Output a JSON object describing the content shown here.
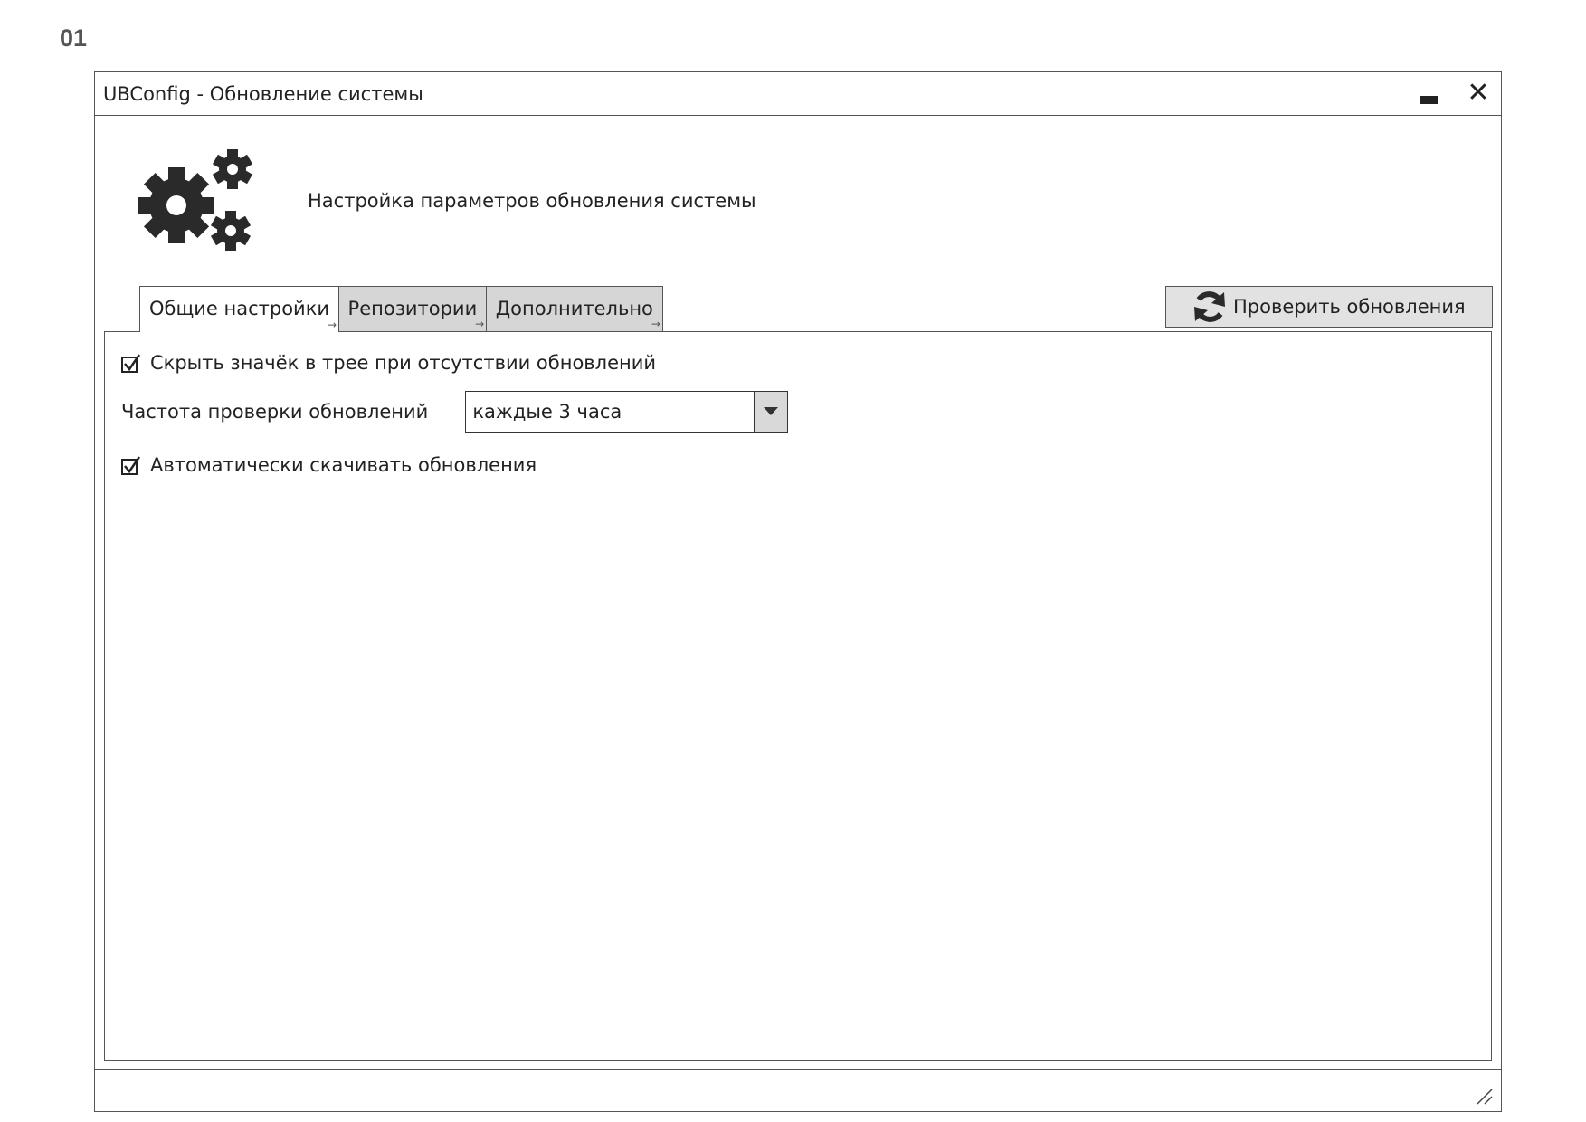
{
  "page": {
    "number": "01"
  },
  "window": {
    "title": "UBConfig - Обновление системы",
    "minimize_icon": "minimize-icon",
    "close_icon": "close-icon",
    "close_glyph": "✕"
  },
  "header": {
    "icon": "gears-icon",
    "text": "Настройка параметров обновления системы"
  },
  "tabs": [
    {
      "label": "Общие настройки",
      "active": true
    },
    {
      "label": "Репозитории",
      "active": false
    },
    {
      "label": "Дополнительно",
      "active": false
    }
  ],
  "check_updates": {
    "label": "Проверить обновления",
    "icon": "refresh-icon"
  },
  "general": {
    "hide_tray_icon": {
      "label": "Скрыть значёк в трее при отсутствии обновлений",
      "checked": true
    },
    "frequency": {
      "label": "Частота проверки обновлений",
      "value": "каждые 3 часа"
    },
    "auto_download": {
      "label": "Автоматически скачивать обновления",
      "checked": true
    }
  },
  "colors": {
    "border": "#555555",
    "tab_inactive": "#d6d6d6",
    "button_bg": "#e2e2e2"
  }
}
